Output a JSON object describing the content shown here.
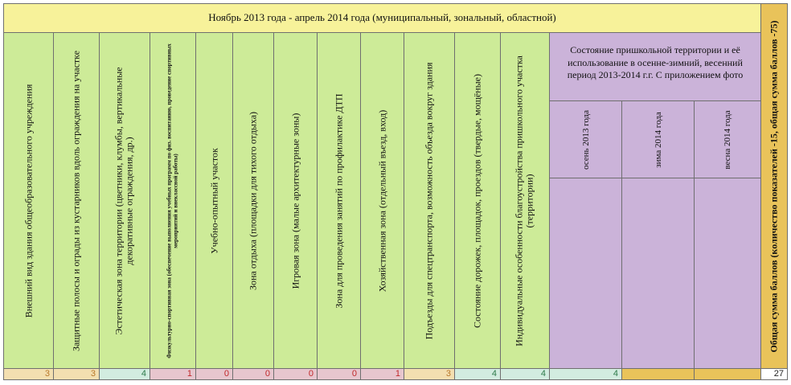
{
  "header": {
    "title": "Ноябрь 2013 года - апрель 2014 года (муниципальный, зональный, областной)"
  },
  "criteria": [
    "Внешний вид здания общеобразовательного учреждения",
    "Защитные полосы и ограды из кустарников вдоль ограждения на участке",
    "Эстетическая зона территории (цветники, клумбы, вертикальные декоративные ограждения, др.)",
    "Физкультурно-спортивная зона (обеспечение выполнения учебных программ по физ. воспитанию, проведение спортивных мероприятий и внеклассной работы)",
    "Учебно-опытный участок",
    "Зона отдыха (площадки для тихого отдыха)",
    "Игровая зона (малые архитектурные зоны)",
    "Зона для проведения занятий по профилактике ДТП",
    "Хозяйственная зона (отдельный въезд, вход)",
    "Подъезды для спецтранспорта, возможность объезда вокруг здания",
    "Состояние дорожек, площадок, проездов (твердые, мощёные)",
    "Индивидуальные особенности благоустройства пришкольного участка (территории)"
  ],
  "photo_section": {
    "title": "Состояние пришкольной территории и её использование в осенне-зимний, весенний период 2013-2014 г.г. С приложением фото",
    "seasons": [
      "осень 2013 года",
      "зима 2014 года",
      "весна 2014 года"
    ]
  },
  "total_header": "Общая сумма баллов (количество показателей -15, общая сумма баллов -75)",
  "scores": [
    "3",
    "3",
    "4",
    "1",
    "0",
    "0",
    "0",
    "0",
    "1",
    "3",
    "4",
    "4",
    "4",
    "",
    "",
    "27"
  ],
  "colors": {
    "header_yellow": "#f7f29a",
    "criteria_green": "#cdeb98",
    "photo_purple": "#cbb3d9",
    "total_gold": "#e9c35a"
  }
}
